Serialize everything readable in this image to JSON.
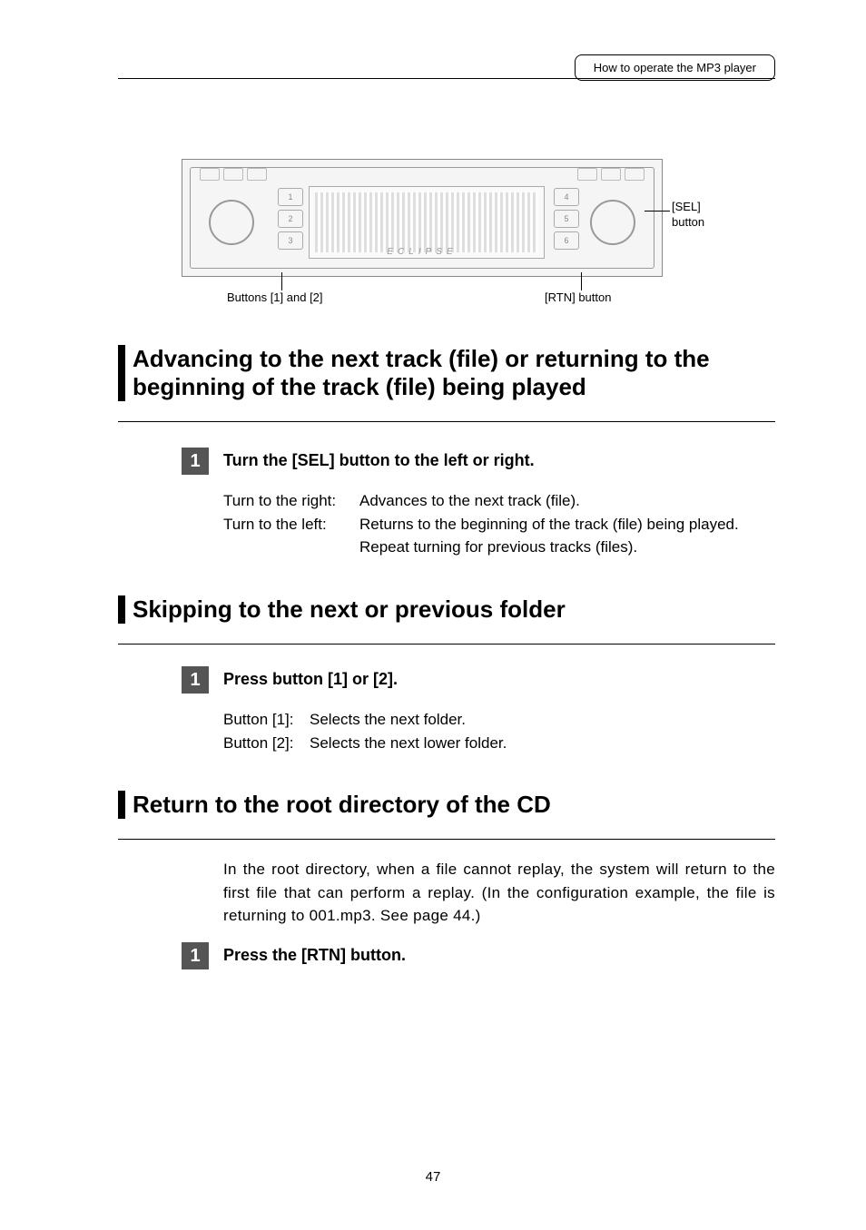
{
  "header": {
    "breadcrumb": "How to operate the MP3 player"
  },
  "diagram": {
    "label_sel": "[SEL]\nbutton",
    "label_buttons12": "Buttons [1] and [2]",
    "label_rtn": "[RTN] button",
    "brand": "ECLIPSE"
  },
  "sections": [
    {
      "title": "Advancing to the next track (file) or returning to the beginning of the track (file) being played",
      "steps": [
        {
          "num": "1",
          "text": "Turn the [SEL] button to the left or right."
        }
      ],
      "details": [
        {
          "label": "Turn to the right:",
          "value": "Advances to the next track (file)."
        },
        {
          "label": "Turn to the left:",
          "value": "Returns to the beginning of the track (file) being played.\nRepeat turning for previous tracks (files)."
        }
      ]
    },
    {
      "title": "Skipping to the next or previous folder",
      "steps": [
        {
          "num": "1",
          "text": "Press button [1] or [2]."
        }
      ],
      "details2": [
        {
          "label": "Button [1]:",
          "value": "Selects the next folder."
        },
        {
          "label": "Button [2]:",
          "value": "Selects the next lower folder."
        }
      ]
    },
    {
      "title": "Return to the root directory of the CD",
      "para": "In the root directory, when a file cannot replay, the system will return to the first file that can perform a replay. (In the configuration example, the file is returning to 001.mp3. See page 44.)",
      "steps": [
        {
          "num": "1",
          "text": "Press the [RTN] button."
        }
      ]
    }
  ],
  "page_number": "47"
}
